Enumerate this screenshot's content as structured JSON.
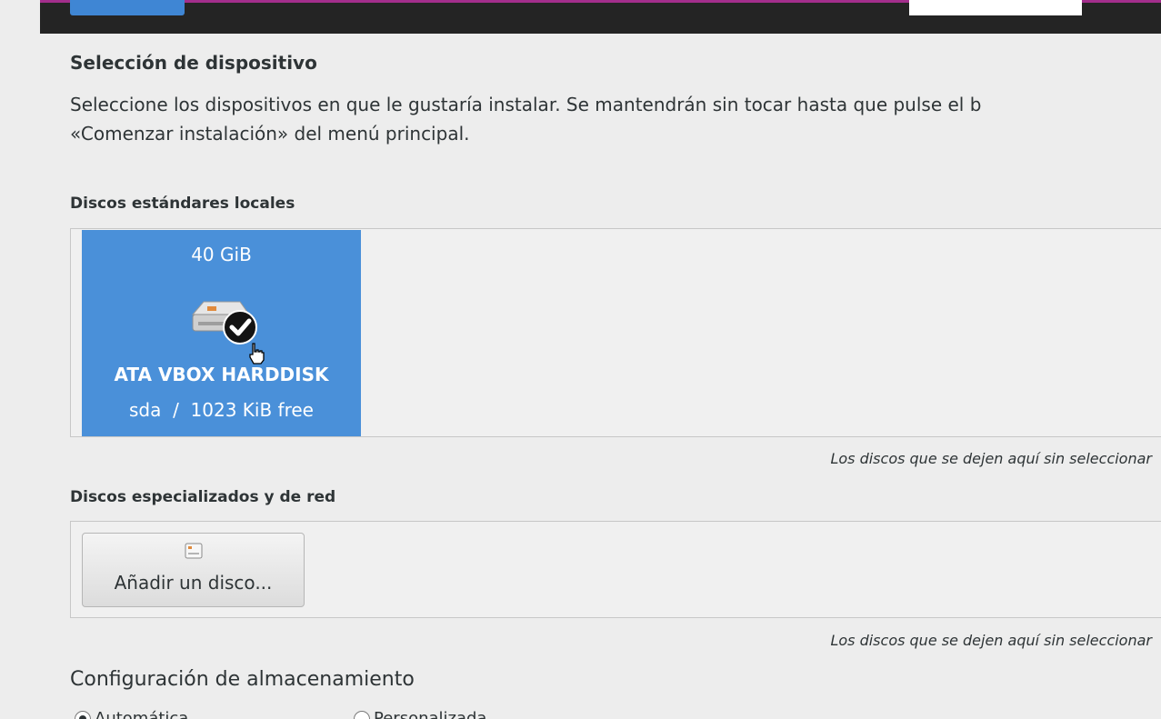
{
  "window": {
    "accent_color": "#a32e8c",
    "header_bg": "#242424"
  },
  "device_selection": {
    "title": "Selección de dispositivo",
    "description_line1": "Seleccione los dispositivos en que le gustaría instalar. Se mantendrán sin tocar hasta que pulse el b",
    "description_line2": "«Comenzar instalación» del menú principal."
  },
  "local_disks": {
    "header": "Discos estándares locales",
    "disks": [
      {
        "size": "40 GiB",
        "model": "ATA VBOX HARDDISK",
        "detail": "sda  /  1023 KiB free",
        "selected": true,
        "icon": "harddisk-checked-icon",
        "color": "#4a90d9"
      }
    ],
    "hint": "Los discos que se dejen aquí sin seleccionar"
  },
  "specialized_disks": {
    "header": "Discos especializados y de red",
    "add_button_label": "Añadir un disco...",
    "add_button_icon": "disk-add-icon",
    "hint": "Los discos que se dejen aquí sin seleccionar"
  },
  "storage_config": {
    "title": "Configuración de almacenamiento",
    "options": [
      {
        "label": "Automática",
        "checked": true
      },
      {
        "label": "Personalizada",
        "checked": false
      }
    ]
  }
}
